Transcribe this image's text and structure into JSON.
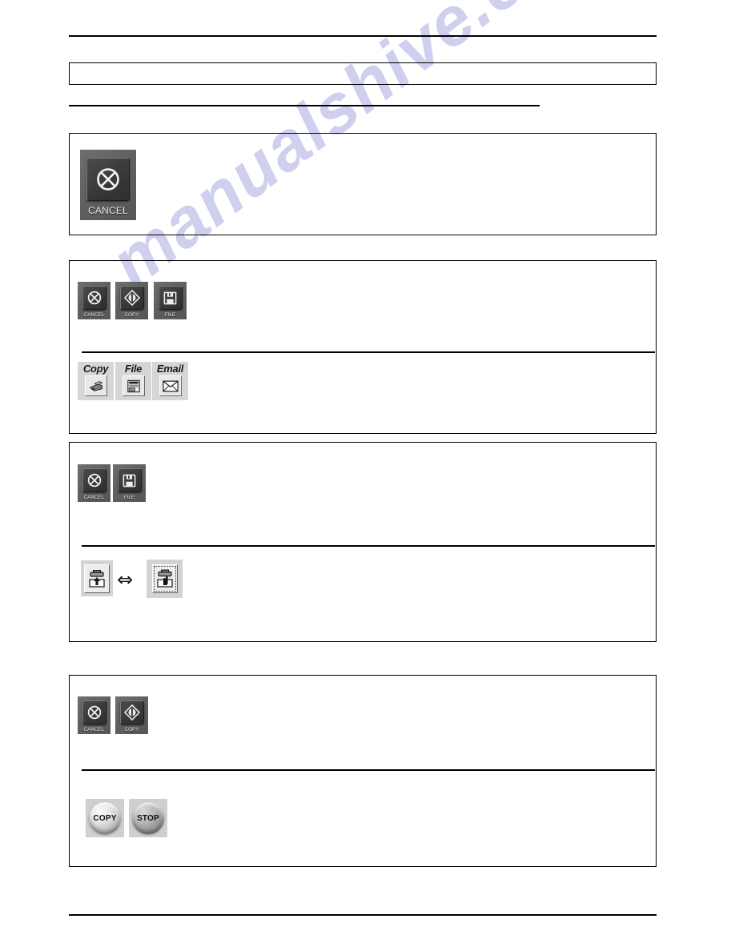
{
  "page": {
    "watermark_text": "manualshive.com",
    "watermark_color": "#cfcfee",
    "background_color": "#ffffff",
    "rule_color": "#000000"
  },
  "header": {
    "rule": "header-rule",
    "title_box_text": "",
    "section_underline": "section-underline"
  },
  "sections": [
    {
      "id": "section-1",
      "buttons": [
        {
          "label": "CANCEL",
          "icon": "cancel-circle-x-icon",
          "style": "panel-dark-large"
        }
      ]
    },
    {
      "id": "section-2",
      "panel_buttons": [
        {
          "label": "CANCEL",
          "icon": "cancel-circle-x-icon"
        },
        {
          "label": "COPY",
          "icon": "copy-diamond-start-icon"
        },
        {
          "label": "FILE",
          "icon": "floppy-disk-icon"
        }
      ],
      "toolbar_buttons": [
        {
          "label": "Copy",
          "icon": "copier-machine-icon"
        },
        {
          "label": "File",
          "icon": "document-form-icon"
        },
        {
          "label": "Email",
          "icon": "envelope-icon"
        }
      ]
    },
    {
      "id": "section-3",
      "panel_buttons": [
        {
          "label": "CANCEL",
          "icon": "cancel-circle-x-icon"
        },
        {
          "label": "FILE",
          "icon": "floppy-disk-icon"
        }
      ],
      "toggle_pair": {
        "left": {
          "icon": "scanner-auto-feed-icon",
          "selected": false
        },
        "right": {
          "icon": "scanner-manual-feed-hand-icon",
          "selected": true
        },
        "arrow_glyph": "⇔"
      }
    },
    {
      "id": "section-4",
      "panel_buttons": [
        {
          "label": "CANCEL",
          "icon": "cancel-circle-x-icon"
        },
        {
          "label": "COPY",
          "icon": "copy-diamond-start-icon"
        }
      ],
      "round_buttons": [
        {
          "label": "COPY",
          "style": "light-silver"
        },
        {
          "label": "STOP",
          "style": "dark-gray"
        }
      ]
    }
  ],
  "footer": {
    "rule": "footer-rule",
    "text": ""
  }
}
